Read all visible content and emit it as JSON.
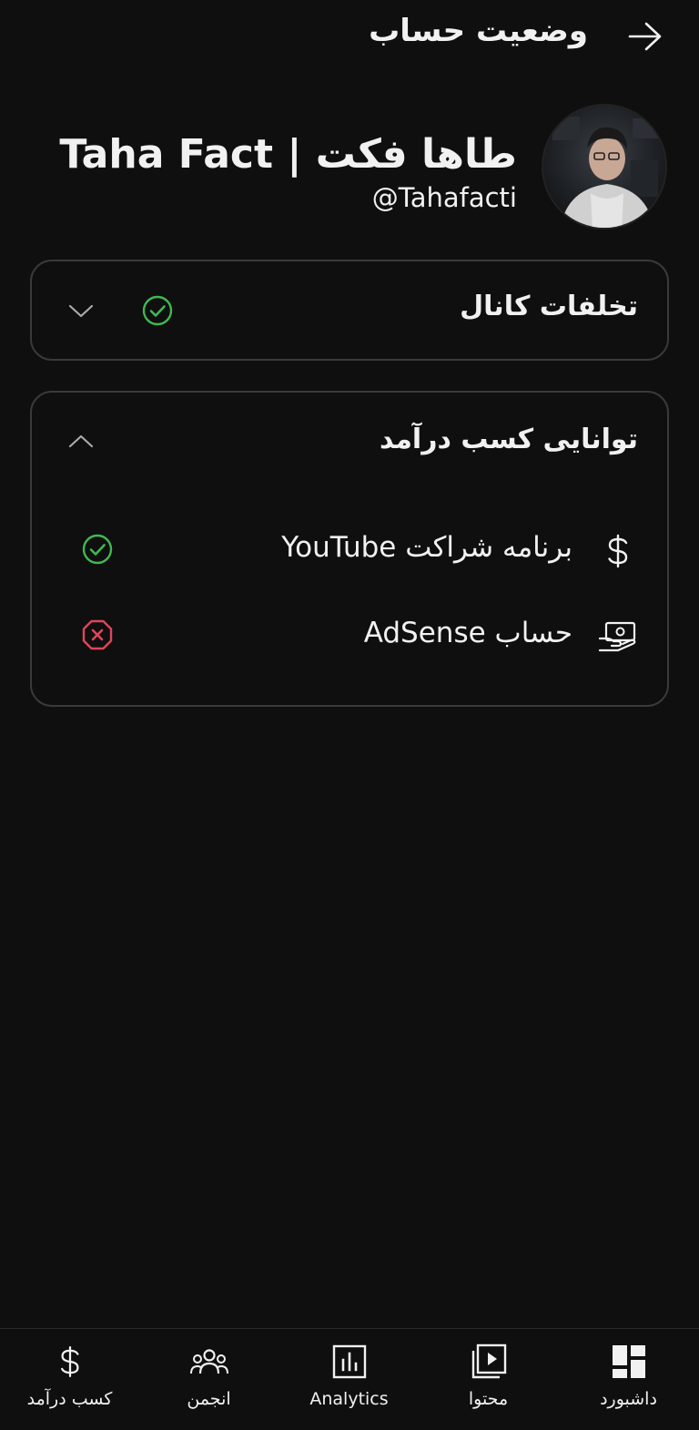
{
  "header": {
    "title": "وضعیت حساب",
    "back_icon": "arrow-right-icon"
  },
  "profile": {
    "channel_name": "Taha Fact | طاها فکت",
    "handle": "@Tahafacti"
  },
  "violations_card": {
    "title": "تخلفات کانال",
    "status": "ok",
    "chevron_icon": "chevron-down-icon"
  },
  "monetization_card": {
    "title": "توانایی کسب درآمد",
    "chevron_icon": "chevron-up-icon",
    "rows": [
      {
        "label": "برنامه شراکت YouTube",
        "icon": "dollar-icon",
        "status": "ok"
      },
      {
        "label": "حساب AdSense",
        "icon": "adsense-icon",
        "status": "error"
      }
    ]
  },
  "bottom_nav": {
    "items": [
      {
        "label": "کسب درآمد",
        "icon": "dollar-icon"
      },
      {
        "label": "انجمن",
        "icon": "community-icon"
      },
      {
        "label": "Analytics",
        "icon": "analytics-icon"
      },
      {
        "label": "محتوا",
        "icon": "content-icon"
      },
      {
        "label": "داشبورد",
        "icon": "dashboard-icon"
      }
    ]
  },
  "colors": {
    "background": "#0f0f0f",
    "text": "#f1f1f1",
    "success": "#3fb950",
    "error": "#e0455a",
    "border": "#3a3a3a"
  }
}
